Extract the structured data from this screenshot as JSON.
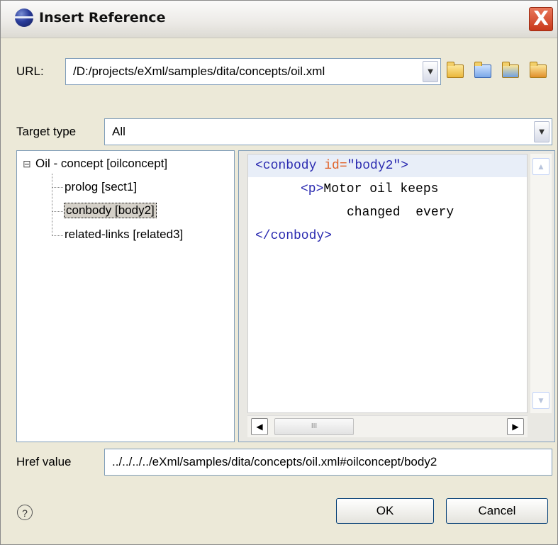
{
  "window": {
    "title": "Insert Reference",
    "close_glyph": "X"
  },
  "url": {
    "label": "URL:",
    "value": "/D:/projects/eXml/samples/dita/concepts/oil.xml",
    "buttons": [
      "open-folder-icon",
      "browse-folder-icon",
      "workspace-folder-icon",
      "archive-folder-icon"
    ]
  },
  "target_type": {
    "label": "Target type",
    "value": "All"
  },
  "tree": {
    "root_toggle": "⊟",
    "root": "Oil - concept [oilconcept]",
    "children": [
      "prolog [sect1]",
      "conbody [body2]",
      "related-links [related3]"
    ],
    "selected_index": 1
  },
  "preview": {
    "line1_open": "<conbody ",
    "line1_attr": "id=",
    "line1_val": "\"body2\">",
    "line2_tag": "<p>",
    "line2_text": "Motor oil keeps",
    "line3": "changed  every",
    "line4": "</conbody>",
    "hscroll_grip": "III"
  },
  "href": {
    "label": "Href value",
    "value": "../../../../eXml/samples/dita/concepts/oil.xml#oilconcept/body2"
  },
  "footer": {
    "help_glyph": "?",
    "ok_label": "OK",
    "cancel_label": "Cancel"
  }
}
